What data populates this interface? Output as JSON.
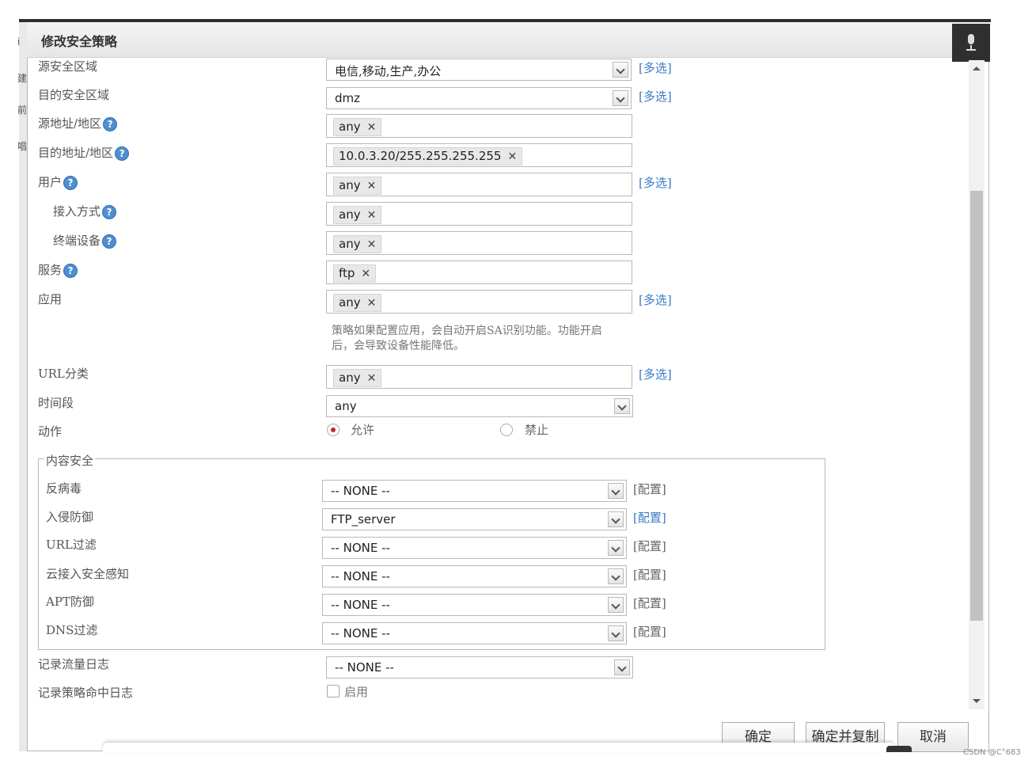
{
  "background": {
    "strip_chars": [
      "i",
      "建",
      "前",
      "唱"
    ]
  },
  "dialog": {
    "title": "修改安全策略"
  },
  "form": {
    "src_zone": {
      "label": "源安全区域",
      "value": "电信,移动,生产,办公",
      "link": "[多选]"
    },
    "dst_zone": {
      "label": "目的安全区域",
      "value": "dmz",
      "link": "[多选]"
    },
    "src_addr": {
      "label": "源地址/地区",
      "tag": "any"
    },
    "dst_addr": {
      "label": "目的地址/地区",
      "tag": "10.0.3.20/255.255.255.255"
    },
    "user": {
      "label": "用户",
      "tag": "any",
      "link": "[多选]"
    },
    "access_mode": {
      "label": "接入方式",
      "tag": "any"
    },
    "terminal": {
      "label": "终端设备",
      "tag": "any"
    },
    "service": {
      "label": "服务",
      "tag": "ftp"
    },
    "app": {
      "label": "应用",
      "tag": "any",
      "link": "[多选]",
      "note_line1": "策略如果配置应用，会自动开启SA识别功能。功能开启",
      "note_line2": "后，会导致设备性能降低。"
    },
    "url_category": {
      "label": "URL分类",
      "tag": "any",
      "link": "[多选]"
    },
    "schedule": {
      "label": "时间段",
      "value": "any"
    },
    "action": {
      "label": "动作",
      "allow": "允许",
      "deny": "禁止",
      "selected": "允许"
    },
    "content_security": {
      "legend": "内容安全",
      "antivirus": {
        "label": "反病毒",
        "value": "-- NONE --",
        "link": "[配置]"
      },
      "ips": {
        "label": "入侵防御",
        "value": "FTP_server",
        "link": "[配置]"
      },
      "url_filter": {
        "label": "URL过滤",
        "value": "-- NONE --",
        "link": "[配置]"
      },
      "cloud_access": {
        "label": "云接入安全感知",
        "value": "-- NONE --",
        "link": "[配置]"
      },
      "apt": {
        "label": "APT防御",
        "value": "-- NONE --",
        "link": "[配置]"
      },
      "dns_filter": {
        "label": "DNS过滤",
        "value": "-- NONE --",
        "link": "[配置]"
      }
    },
    "traffic_log": {
      "label": "记录流量日志",
      "value": "-- NONE --"
    },
    "hit_log": {
      "label": "记录策略命中日志",
      "checkbox_label": "启用"
    }
  },
  "buttons": {
    "ok": "确定",
    "ok_copy": "确定并复制",
    "cancel": "取消"
  },
  "watermark": "CSDN @C°683",
  "help_glyph": "?",
  "remove_glyph": "✕",
  "colors": {
    "link": "#3b7bc4",
    "radio_selected": "#c0282e",
    "help_icon": "#4f8fd0",
    "titlebar_dark": "#2f2f2f"
  }
}
